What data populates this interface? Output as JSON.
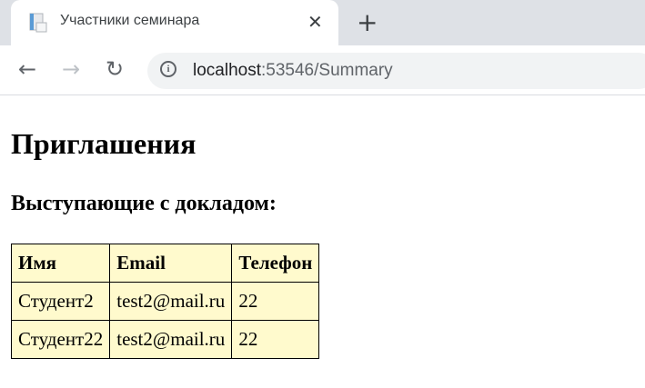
{
  "browser": {
    "tab_title": "Участники семинара",
    "url_host": "localhost",
    "url_rest": ":53546/Summary"
  },
  "page": {
    "title": "Приглашения",
    "subtitle": "Выступающие с докладом:",
    "table": {
      "headers": [
        "Имя",
        "Email",
        "Телефон"
      ],
      "rows": [
        [
          "Студент2",
          "test2@mail.ru",
          "22"
        ],
        [
          "Студент22",
          "test2@mail.ru",
          "22"
        ]
      ]
    }
  }
}
